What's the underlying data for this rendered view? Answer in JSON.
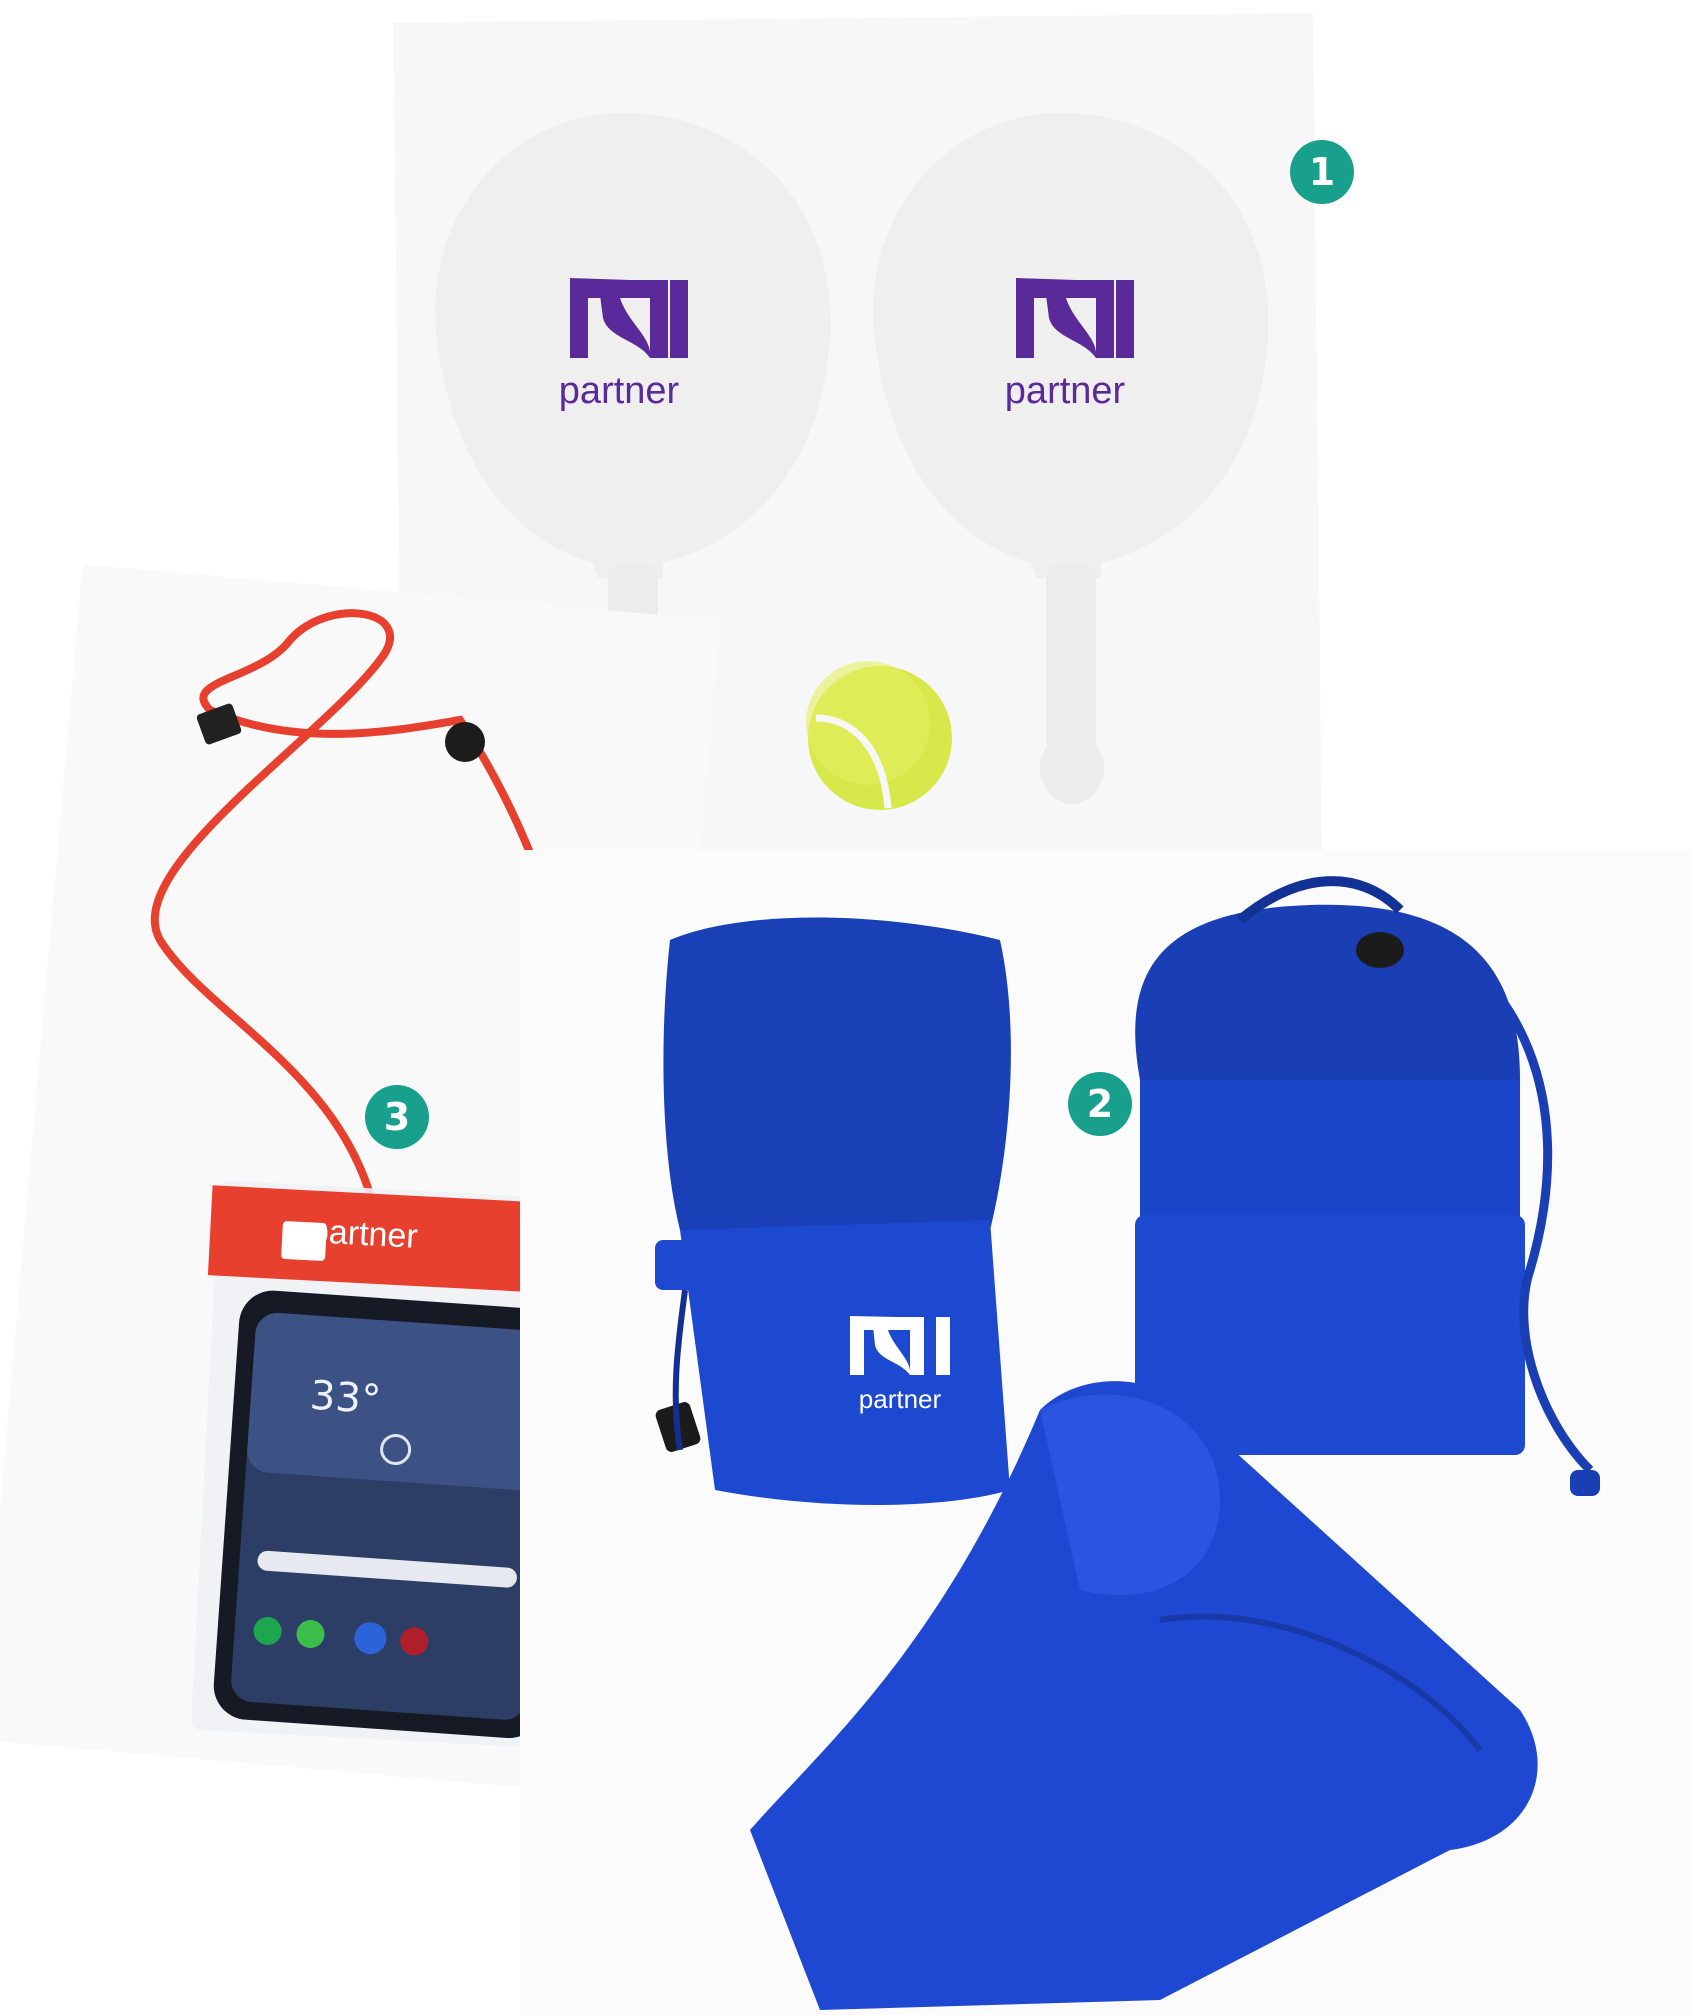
{
  "badges": {
    "one": "1",
    "two": "2",
    "three": "3"
  },
  "brand": {
    "wordmark": "partner",
    "purple": "#5b2a9a",
    "red": "#e8402e",
    "blue": "#1540c8",
    "teal": "#18a08c"
  },
  "phone": {
    "temperature": "33°"
  },
  "products": [
    {
      "id": "1",
      "name_icon": "paddle-rackets-with-ball"
    },
    {
      "id": "2",
      "name_icon": "mesh-bags-and-towel"
    },
    {
      "id": "3",
      "name_icon": "waterproof-phone-pouch"
    }
  ]
}
